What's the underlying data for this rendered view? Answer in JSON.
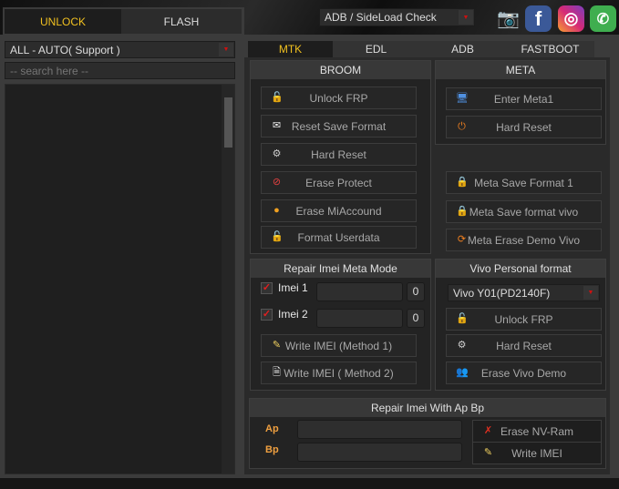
{
  "top_tabs": [
    {
      "label": "UNLOCK",
      "active": true
    },
    {
      "label": "FLASH",
      "active": false
    }
  ],
  "adb_check": {
    "value": "ADB / SideLoad Check"
  },
  "social": [
    {
      "icon": "camera-icon"
    },
    {
      "icon": "facebook-icon",
      "glyph": "f"
    },
    {
      "icon": "instagram-icon",
      "glyph": "◎"
    },
    {
      "icon": "whatsapp-icon",
      "glyph": "✆"
    }
  ],
  "left": {
    "brand_select": "ALL - AUTO( Support )",
    "search_placeholder": "-- search here --"
  },
  "right_tabs": [
    {
      "label": "MTK",
      "active": true
    },
    {
      "label": "EDL"
    },
    {
      "label": "ADB"
    },
    {
      "label": "FASTBOOT"
    }
  ],
  "broom": {
    "title": "BROOM",
    "buttons": [
      "Unlock FRP",
      "Reset Save Format",
      "Hard Reset",
      "Erase Protect",
      "Erase MiAccound",
      "Format Userdata"
    ]
  },
  "meta": {
    "title": "META",
    "buttons": [
      "Enter Meta1",
      "Hard Reset"
    ],
    "extra_buttons": [
      "Meta Save Format 1",
      "Meta Save format vivo",
      "Meta Erase Demo Vivo"
    ]
  },
  "repair_meta": {
    "title": "Repair Imei Meta Mode",
    "imei1": {
      "label": "Imei 1",
      "checked": true,
      "value": "",
      "count": "0"
    },
    "imei2": {
      "label": "Imei 2",
      "checked": true,
      "value": "",
      "count": "0"
    },
    "buttons": [
      "Write IMEI (Method 1)",
      "Write IMEI ( Method 2)"
    ]
  },
  "vivo": {
    "title": "Vivo Personal format",
    "model": "Vivo Y01(PD2140F)",
    "buttons": [
      "Unlock FRP",
      "Hard Reset",
      "Erase Vivo Demo"
    ]
  },
  "apbp": {
    "title": "Repair Imei With Ap Bp",
    "ap_label": "Ap",
    "bp_label": "Bp",
    "ap_value": "",
    "bp_value": "",
    "buttons": [
      "Erase NV-Ram",
      "Write IMEI"
    ]
  },
  "colors": {
    "active_tab": "#f0c020",
    "accent_red": "#d01010"
  }
}
